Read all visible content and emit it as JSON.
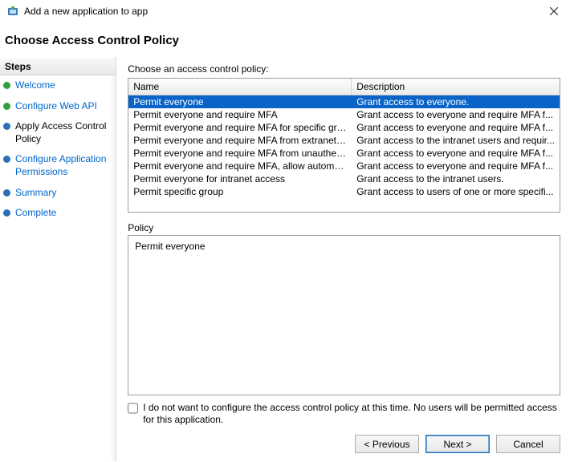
{
  "window": {
    "title": "Add a new application to app",
    "page_title": "Choose Access Control Policy"
  },
  "sidebar": {
    "header": "Steps",
    "items": [
      {
        "label": "Welcome",
        "state": "done"
      },
      {
        "label": "Configure Web API",
        "state": "done"
      },
      {
        "label": "Apply Access Control Policy",
        "state": "current"
      },
      {
        "label": "Configure Application Permissions",
        "state": "pending"
      },
      {
        "label": "Summary",
        "state": "pending"
      },
      {
        "label": "Complete",
        "state": "pending"
      }
    ]
  },
  "main": {
    "instruction": "Choose an access control policy:",
    "columns": {
      "name": "Name",
      "desc": "Description"
    },
    "policies": [
      {
        "name": "Permit everyone",
        "desc": "Grant access to everyone.",
        "selected": true
      },
      {
        "name": "Permit everyone and require MFA",
        "desc": "Grant access to everyone and require MFA f..."
      },
      {
        "name": "Permit everyone and require MFA for specific group",
        "desc": "Grant access to everyone and require MFA f..."
      },
      {
        "name": "Permit everyone and require MFA from extranet access",
        "desc": "Grant access to the intranet users and requir..."
      },
      {
        "name": "Permit everyone and require MFA from unauthenticated ...",
        "desc": "Grant access to everyone and require MFA f..."
      },
      {
        "name": "Permit everyone and require MFA, allow automatic devi...",
        "desc": "Grant access to everyone and require MFA f..."
      },
      {
        "name": "Permit everyone for intranet access",
        "desc": "Grant access to the intranet users."
      },
      {
        "name": "Permit specific group",
        "desc": "Grant access to users of one or more specifi..."
      }
    ],
    "policy_label": "Policy",
    "policy_detail": "Permit everyone",
    "skip_checkbox_label": "I do not want to configure the access control policy at this time.  No users will be permitted access for this application."
  },
  "buttons": {
    "previous": "< Previous",
    "next": "Next >",
    "cancel": "Cancel"
  }
}
